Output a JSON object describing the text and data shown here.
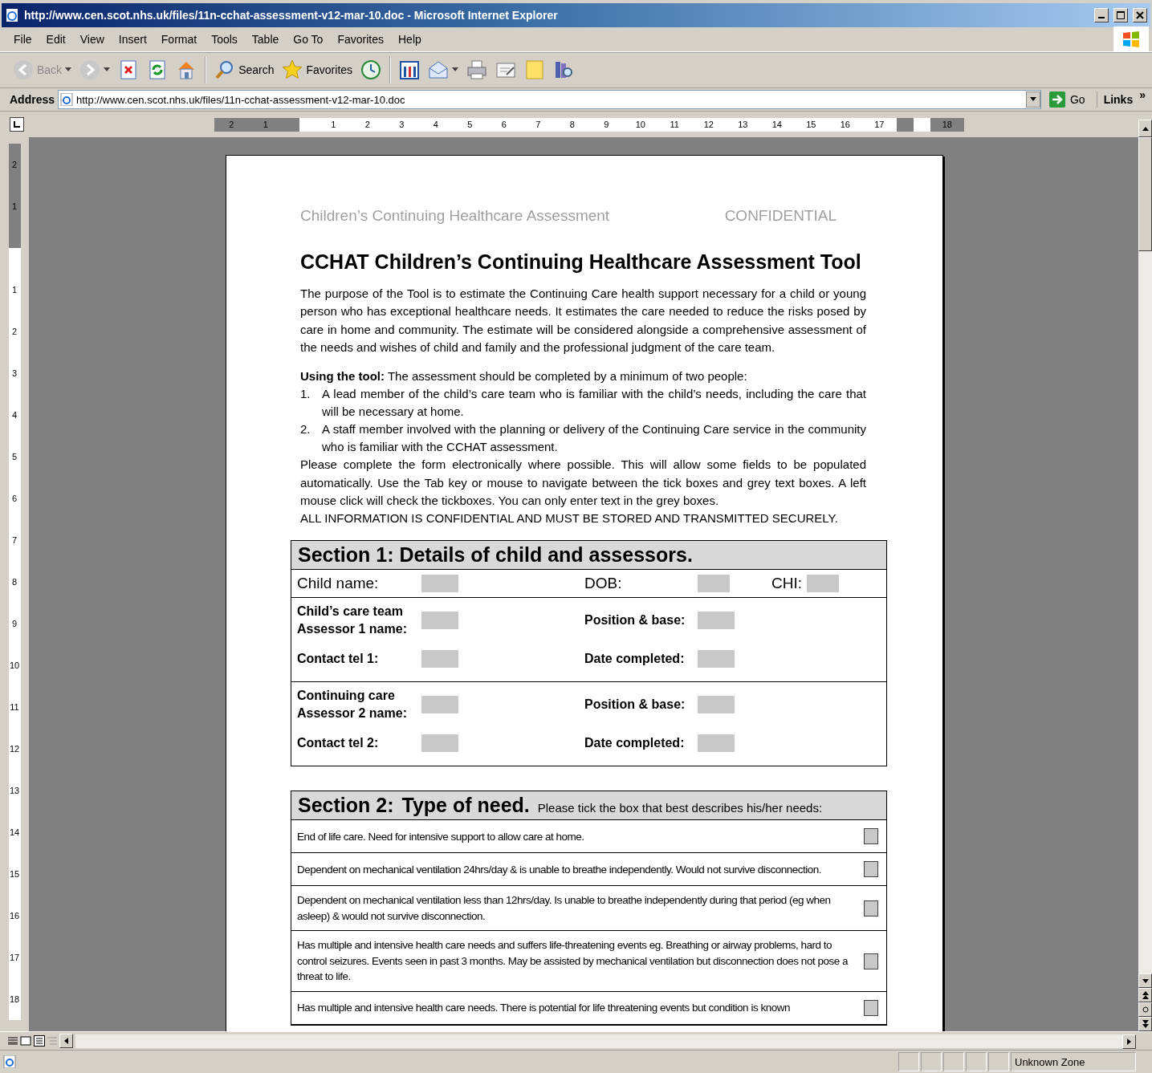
{
  "window": {
    "title": "http://www.cen.scot.nhs.uk/files/11n-cchat-assessment-v12-mar-10.doc - Microsoft Internet Explorer"
  },
  "menu": [
    "File",
    "Edit",
    "View",
    "Insert",
    "Format",
    "Tools",
    "Table",
    "Go To",
    "Favorites",
    "Help"
  ],
  "toolbar": [
    {
      "kind": "back",
      "label": "Back",
      "disabled": true,
      "dropdown": true
    },
    {
      "kind": "forward",
      "disabled": true,
      "dropdown": true
    },
    {
      "kind": "stop"
    },
    {
      "kind": "refresh"
    },
    {
      "kind": "home"
    },
    {
      "kind": "separator"
    },
    {
      "kind": "search",
      "label": "Search"
    },
    {
      "kind": "favorites",
      "label": "Favorites"
    },
    {
      "kind": "history"
    },
    {
      "kind": "separator"
    },
    {
      "kind": "tools"
    },
    {
      "kind": "mail",
      "dropdown": true
    },
    {
      "kind": "print"
    },
    {
      "kind": "edit"
    },
    {
      "kind": "note"
    },
    {
      "kind": "research"
    }
  ],
  "address": {
    "label": "Address",
    "url": "http://www.cen.scot.nhs.uk/files/11n-cchat-assessment-v12-mar-10.doc",
    "go": "Go",
    "links": "Links",
    "more": "»"
  },
  "ruler": {
    "horizontal": [
      {
        "label": "2",
        "margin": true
      },
      {
        "label": "1",
        "margin": true
      },
      {
        "label": "1",
        "margin": false
      },
      {
        "label": "2",
        "margin": false
      },
      {
        "label": "3",
        "margin": false
      },
      {
        "label": "4",
        "margin": false
      },
      {
        "label": "5",
        "margin": false
      },
      {
        "label": "6",
        "margin": false
      },
      {
        "label": "7",
        "margin": false
      },
      {
        "label": "8",
        "margin": false
      },
      {
        "label": "9",
        "margin": false
      },
      {
        "label": "10",
        "margin": false
      },
      {
        "label": "11",
        "margin": false
      },
      {
        "label": "12",
        "margin": false
      },
      {
        "label": "13",
        "margin": false
      },
      {
        "label": "14",
        "margin": false
      },
      {
        "label": "15",
        "margin": false
      },
      {
        "label": "16",
        "margin": false
      },
      {
        "label": "17",
        "margin": false
      },
      {
        "label": "18",
        "margin": true
      }
    ],
    "vertical": [
      {
        "label": "2",
        "margin": true
      },
      {
        "label": "1",
        "margin": true
      },
      {
        "label": "1",
        "margin": false
      },
      {
        "label": "2",
        "margin": false
      },
      {
        "label": "3",
        "margin": false
      },
      {
        "label": "4",
        "margin": false
      },
      {
        "label": "5",
        "margin": false
      },
      {
        "label": "6",
        "margin": false
      },
      {
        "label": "7",
        "margin": false
      },
      {
        "label": "8",
        "margin": false
      },
      {
        "label": "9",
        "margin": false
      },
      {
        "label": "10",
        "margin": false
      },
      {
        "label": "11",
        "margin": false
      },
      {
        "label": "12",
        "margin": false
      },
      {
        "label": "13",
        "margin": false
      },
      {
        "label": "14",
        "margin": false
      },
      {
        "label": "15",
        "margin": false
      },
      {
        "label": "16",
        "margin": false
      },
      {
        "label": "17",
        "margin": false
      },
      {
        "label": "18",
        "margin": false
      }
    ]
  },
  "document": {
    "header_left": "Children’s Continuing Healthcare Assessment",
    "header_right": "CONFIDENTIAL",
    "title": "CCHAT Children’s Continuing Healthcare Assessment Tool",
    "intro": "The purpose of the Tool is to estimate the Continuing Care health support necessary for a child or young person who has exceptional healthcare needs.  It estimates the care needed to reduce the risks posed by care in home and community. The estimate will be considered alongside a comprehensive assessment of the needs and wishes of child and family and the professional judgment of the care team.",
    "using": "**Using the tool:** The assessment should be completed by a minimum of two people:",
    "steps": [
      {
        "number": "1.",
        "text": "A lead member of the child’s care team who is familiar with the child’s needs, including the care that will be necessary at home."
      },
      {
        "number": "2.",
        "text": "A staff member involved with the planning or delivery of the Continuing Care service in the community who is familiar with the CCHAT assessment."
      }
    ],
    "instructions": "Please complete the form electronically where possible. This will allow some fields to be populated automatically. Use the Tab key or mouse to navigate between the tick boxes and grey text boxes. A left mouse click will check the tickboxes.  You can only enter text in the grey boxes.",
    "warning": "ALL INFORMATION IS CONFIDENTIAL AND MUST BE STORED AND TRANSMITTED SECURELY.",
    "section1": {
      "title": "Section 1: Details of child and assessors.",
      "child": [
        {
          "label": "Child name:"
        },
        {
          "label": "DOB:"
        },
        {
          "label": "CHI:"
        }
      ],
      "groups": [
        [
          {
            "label": "Child’s care team Assessor 1 name:",
            "pair": "Position & base:"
          },
          {
            "label": "Contact tel 1:",
            "pair": "Date completed:"
          }
        ],
        [
          {
            "label": "Continuing care Assessor 2 name:",
            "pair": "Position & base:"
          },
          {
            "label": "Contact tel 2:",
            "pair": "Date completed:"
          }
        ]
      ]
    },
    "section2": {
      "number": "Section 2:",
      "title": "Type of need.",
      "note": "Please tick the box that best describes his/her needs:",
      "needs": [
        {
          "text": "End of life care. Need for intensive support to allow care at home.",
          "checked": false
        },
        {
          "text": "Dependent on mechanical ventilation 24hrs/day & is unable to breathe independently.  Would not survive disconnection.",
          "checked": false
        },
        {
          "text": "Dependent on mechanical ventilation less than 12hrs/day.  Is unable to breathe independently during that period (eg when asleep) & would not survive disconnection.",
          "checked": false
        },
        {
          "text": "Has multiple and intensive health care needs and suffers life-threatening events eg. Breathing or airway problems, hard to control seizures. Events seen in past 3 months. May be assisted by mechanical ventilation but disconnection does not pose a  threat to life.",
          "checked": false
        },
        {
          "text": "Has multiple and intensive health care needs.  There is potential for life threatening events but condition is known",
          "checked": false
        }
      ]
    }
  },
  "status": {
    "zone": "Unknown Zone"
  }
}
